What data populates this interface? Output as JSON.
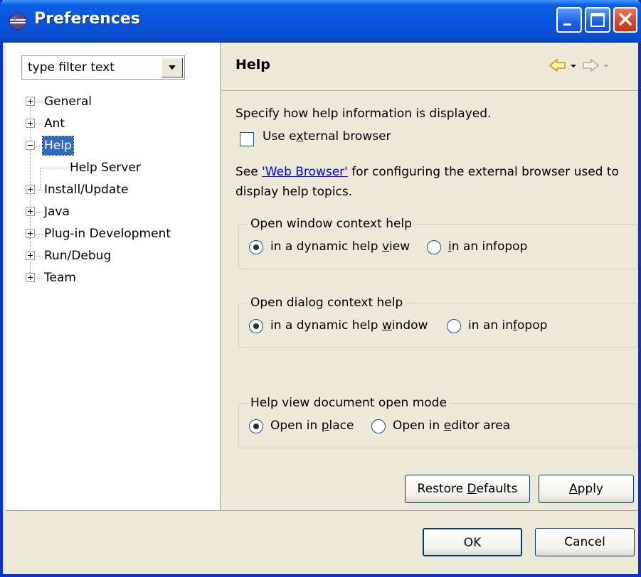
{
  "window": {
    "title": "Preferences",
    "icon": "eclipse-icon"
  },
  "sidebar": {
    "filter_value": "type filter text",
    "items": [
      {
        "label": "General",
        "expander": "plus"
      },
      {
        "label": "Ant",
        "expander": "plus"
      },
      {
        "label": "Help",
        "expander": "minus",
        "selected": true
      },
      {
        "label": "Help Server",
        "expander": "none",
        "child": true
      },
      {
        "label": "Install/Update",
        "expander": "plus"
      },
      {
        "label": "Java",
        "expander": "plus"
      },
      {
        "label": "Plug-in Development",
        "expander": "plus"
      },
      {
        "label": "Run/Debug",
        "expander": "plus"
      },
      {
        "label": "Team",
        "expander": "plus"
      }
    ]
  },
  "page": {
    "title": "Help",
    "description": "Specify how help information is displayed.",
    "external_browser": {
      "label_pre": "Use e",
      "label_mn": "x",
      "label_post": "ternal browser",
      "checked": false
    },
    "see_text_pre": "See ",
    "see_link": "'Web Browser'",
    "see_text_post": " for configuring the external browser used to display help topics.",
    "groups": [
      {
        "title": "Open window context help",
        "options": [
          {
            "pre": "in a dynamic help ",
            "mn": "v",
            "post": "iew",
            "selected": true
          },
          {
            "pre": "",
            "mn": "i",
            "post": "n an infopop",
            "selected": false
          }
        ]
      },
      {
        "title": "Open dialog context help",
        "options": [
          {
            "pre": "in a dynamic help ",
            "mn": "w",
            "post": "indow",
            "selected": true
          },
          {
            "pre": "in an in",
            "mn": "f",
            "post": "opop",
            "selected": false
          }
        ]
      },
      {
        "title": "Help view document open mode",
        "options": [
          {
            "pre": "Open in ",
            "mn": "p",
            "post": "lace",
            "selected": true
          },
          {
            "pre": "Open in ",
            "mn": "e",
            "post": "ditor area",
            "selected": false
          }
        ]
      }
    ],
    "restore_defaults": {
      "pre": "Restore ",
      "mn": "D",
      "post": "efaults"
    },
    "apply": {
      "pre": "",
      "mn": "A",
      "post": "pply"
    }
  },
  "footer": {
    "ok_label": "OK",
    "cancel_label": "Cancel"
  }
}
